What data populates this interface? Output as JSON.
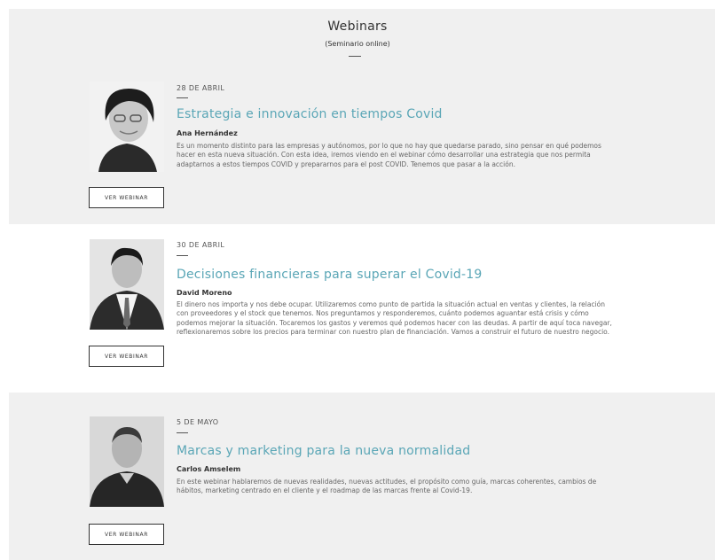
{
  "page": {
    "title": "Webinars",
    "subtitle": "(Seminario online)"
  },
  "webinars": [
    {
      "date": "28 DE ABRIL",
      "title": "Estrategia e innovación en tiempos Covid",
      "speaker": "Ana Hernández",
      "description": "Es un momento distinto para las empresas y autónomos, por lo que no hay que quedarse parado, sino pensar en qué podemos hacer en esta nueva situación. Con esta idea, iremos viendo en el webinar cómo desarrollar una estrategia que nos permita adaptarnos a estos tiempos COVID y prepararnos para el post COVID. Tenemos que pasar a la acción.",
      "button": "VER WEBINAR"
    },
    {
      "date": "30 DE ABRIL",
      "title": "Decisiones financieras para superar el Covid-19",
      "speaker": "David Moreno",
      "description": "El dinero nos importa y nos debe ocupar. Utilizaremos como punto de partida la situación actual en ventas y clientes, la relación con proveedores y el stock que tenemos. Nos preguntamos y responderemos, cuánto podemos aguantar está crisis y cómo podemos mejorar la situación. Tocaremos los gastos y veremos qué podemos hacer con las deudas. A partir de aquí toca navegar, reflexionaremos sobre los precios para terminar con nuestro plan de financiación. Vamos a construir el futuro de nuestro negocio.",
      "button": "VER WEBINAR"
    },
    {
      "date": "5 DE MAYO",
      "title": "Marcas y marketing para la nueva normalidad",
      "speaker": "Carlos Amselem",
      "description": "En este webinar hablaremos de nuevas realidades, nuevas actitudes, el propósito como guía, marcas coherentes, cambios de hábitos, marketing centrado en el cliente y el roadmap de las marcas frente al Covid-19.",
      "button": "VER WEBINAR"
    }
  ],
  "colors": {
    "accent": "#5aa6b6",
    "section_bg": "#f0f0f0"
  }
}
